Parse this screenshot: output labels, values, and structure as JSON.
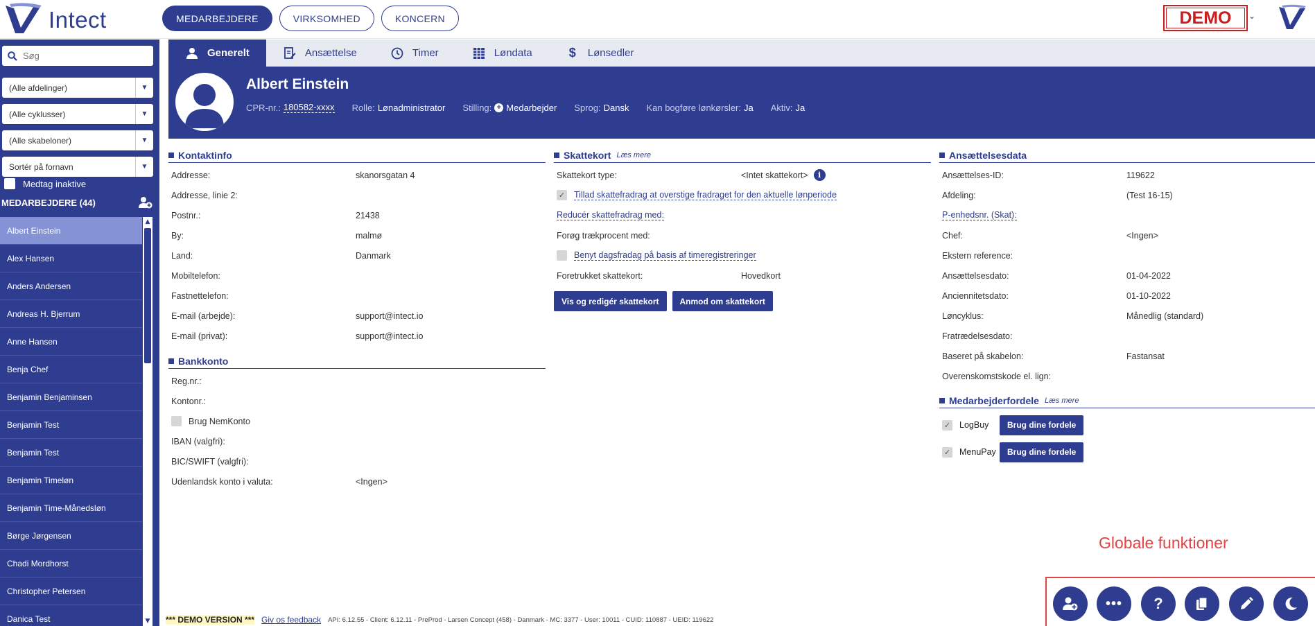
{
  "brand": {
    "name": "Intect",
    "color": "#2e3d8f"
  },
  "topnav": [
    {
      "label": "MEDARBEJDERE",
      "active": true
    },
    {
      "label": "VIRKSOMHED",
      "active": false
    },
    {
      "label": "KONCERN",
      "active": false
    }
  ],
  "demo_badge": "DEMO",
  "sidebar": {
    "search_placeholder": "Søg",
    "filters": [
      "(Alle afdelinger)",
      "(Alle cyklusser)",
      "(Alle skabeloner)",
      "Sortér på fornavn"
    ],
    "include_inactive": "Medtag inaktive",
    "employees_header": "MEDARBEJDERE (44)",
    "employees": [
      "Albert Einstein",
      "Alex Hansen",
      "Anders Andersen",
      "Andreas H. Bjerrum",
      "Anne Hansen",
      "Benja Chef",
      "Benjamin Benjaminsen",
      "Benjamin Test",
      "Benjamin Test",
      "Benjamin Timeløn",
      "Benjamin Time-Månedsløn",
      "Børge Jørgensen",
      "Chadi Mordhorst",
      "Christopher Petersen",
      "Danica Test"
    ]
  },
  "tabs": [
    "Generelt",
    "Ansættelse",
    "Timer",
    "Løndata",
    "Lønsedler"
  ],
  "profile": {
    "name": "Albert Einstein",
    "cpr_label": "CPR-nr.:",
    "cpr": "180582-xxxx",
    "rolle_label": "Rolle:",
    "rolle": "Lønadministrator",
    "stilling_label": "Stilling:",
    "stilling": "Medarbejder",
    "sprog_label": "Sprog:",
    "sprog": "Dansk",
    "bogfore_label": "Kan bogføre lønkørsler:",
    "bogfore": "Ja",
    "aktiv_label": "Aktiv:",
    "aktiv": "Ja"
  },
  "kontaktinfo": {
    "title": "Kontaktinfo",
    "rows": [
      {
        "label": "Addresse:",
        "value": "skanorsgatan 4"
      },
      {
        "label": "Addresse, linie 2:",
        "value": ""
      },
      {
        "label": "Postnr.:",
        "value": "21438"
      },
      {
        "label": "By:",
        "value": "malmø"
      },
      {
        "label": "Land:",
        "value": "Danmark"
      },
      {
        "label": "Mobiltelefon:",
        "value": ""
      },
      {
        "label": "Fastnettelefon:",
        "value": ""
      },
      {
        "label": "E-mail (arbejde):",
        "value": "support@intect.io"
      },
      {
        "label": "E-mail (privat):",
        "value": "support@intect.io"
      }
    ]
  },
  "bankkonto": {
    "title": "Bankkonto",
    "reg": "Reg.nr.:",
    "konto": "Kontonr.:",
    "nemkonto": "Brug NemKonto",
    "iban": "IBAN (valgfri):",
    "bic": "BIC/SWIFT (valgfri):",
    "udenlandsk": "Udenlandsk konto i valuta:",
    "udenlandsk_value": "<Ingen>"
  },
  "skattekort": {
    "title": "Skattekort",
    "laes_mere": "Læs mere",
    "type_label": "Skattekort type:",
    "type_value": "<Intet skattekort>",
    "tillad": "Tillad skattefradrag at overstige fradraget for den aktuelle lønperiode",
    "reducer": "Reducér skattefradrag med:",
    "forog": "Forøg trækprocent med:",
    "benyt": "Benyt dagsfradag på basis af timeregistreringer",
    "foretrukket_label": "Foretrukket skattekort:",
    "foretrukket_value": "Hovedkort",
    "btn_vis": "Vis og redigér skattekort",
    "btn_anmod": "Anmod om skattekort"
  },
  "ansaettelse": {
    "title": "Ansættelsesdata",
    "rows": [
      {
        "label": "Ansættelses-ID:",
        "value": "119622"
      },
      {
        "label": "Afdeling:",
        "value": "(Test 16-15)"
      },
      {
        "label": "P-enhedsnr. (Skat):",
        "value": ""
      },
      {
        "label": "Chef:",
        "value": "<Ingen>"
      },
      {
        "label": "Ekstern reference:",
        "value": ""
      },
      {
        "label": "Ansættelsesdato:",
        "value": "01-04-2022"
      },
      {
        "label": "Anciennitetsdato:",
        "value": "01-10-2022"
      },
      {
        "label": "Løncyklus:",
        "value": "Månedlig (standard)"
      },
      {
        "label": "Fratrædelsesdato:",
        "value": ""
      },
      {
        "label": "Baseret på skabelon:",
        "value": "Fastansat"
      },
      {
        "label": "Overenskomstskode el. lign:",
        "value": ""
      }
    ]
  },
  "fordele": {
    "title": "Medarbejderfordele",
    "laes_mere": "Læs mere",
    "items": [
      {
        "label": "LogBuy",
        "button": "Brug dine fordele"
      },
      {
        "label": "MenuPay",
        "button": "Brug dine fordele"
      }
    ]
  },
  "annotation": "Globale funktioner",
  "footer": {
    "demo": "*** DEMO VERSION ***",
    "feedback": "Giv os feedback",
    "version": "API: 6.12.55 - Client: 6.12.11 - PreProd - Larsen Concept (458) - Danmark - MC: 3377 - User: 10011 - CUID: 110887 - UEID: 119622"
  },
  "fab_icons": [
    "add-user-icon",
    "more-icon",
    "help-icon",
    "copy-icon",
    "edit-icon",
    "dark-mode-icon"
  ]
}
